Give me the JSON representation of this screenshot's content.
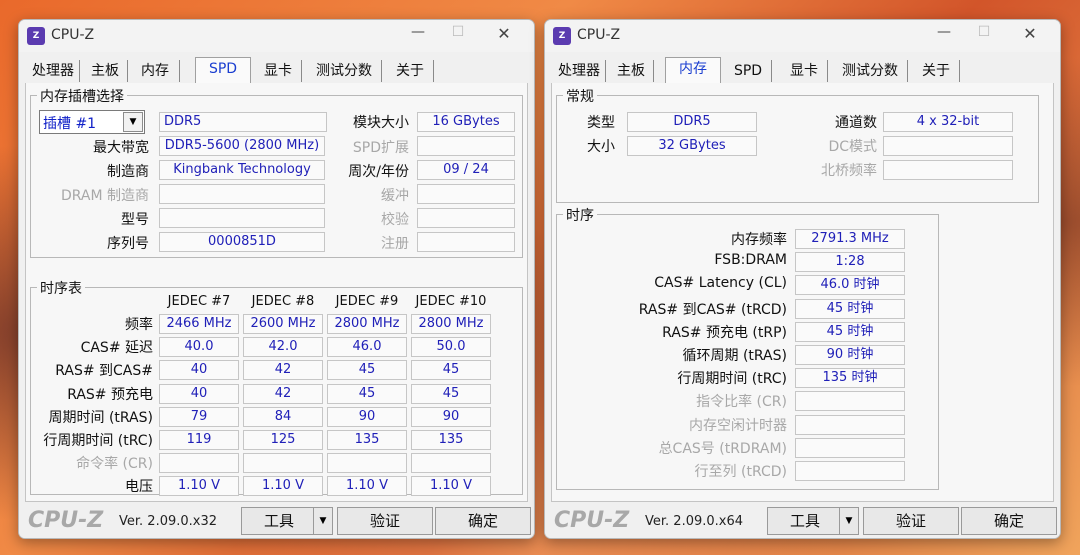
{
  "left_window": {
    "title": "CPU-Z",
    "tabs": [
      "处理器",
      "主板",
      "内存",
      "SPD",
      "显卡",
      "测试分数",
      "关于"
    ],
    "active_tab": "SPD",
    "slot_group": {
      "title": "内存插槽选择",
      "slot_select": "插槽 #1",
      "type": "DDR5",
      "module_size_label": "模块大小",
      "module_size": "16 GBytes",
      "max_bandwidth_label": "最大带宽",
      "max_bandwidth": "DDR5-5600 (2800 MHz)",
      "spd_ext_label": "SPD扩展",
      "spd_ext": "",
      "manufacturer_label": "制造商",
      "manufacturer": "Kingbank Technology",
      "week_year_label": "周次/年份",
      "week_year": "09 / 24",
      "dram_mfr_label": "DRAM 制造商",
      "dram_mfr": "",
      "buffer_label": "缓冲",
      "buffer": "",
      "part_label": "型号",
      "part": "",
      "check_label": "校验",
      "check": "",
      "serial_label": "序列号",
      "serial": "0000851D",
      "reg_label": "注册",
      "reg": ""
    },
    "timing_group": {
      "title": "时序表",
      "columns": [
        "JEDEC #7",
        "JEDEC #8",
        "JEDEC #9",
        "JEDEC #10"
      ],
      "rows": [
        {
          "label": "频率",
          "values": [
            "2466 MHz",
            "2600 MHz",
            "2800 MHz",
            "2800 MHz"
          ]
        },
        {
          "label": "CAS# 延迟",
          "values": [
            "40.0",
            "42.0",
            "46.0",
            "50.0"
          ]
        },
        {
          "label": "RAS# 到CAS#",
          "values": [
            "40",
            "42",
            "45",
            "45"
          ]
        },
        {
          "label": "RAS# 预充电",
          "values": [
            "40",
            "42",
            "45",
            "45"
          ]
        },
        {
          "label": "周期时间 (tRAS)",
          "values": [
            "79",
            "84",
            "90",
            "90"
          ]
        },
        {
          "label": "行周期时间 (tRC)",
          "values": [
            "119",
            "125",
            "135",
            "135"
          ]
        },
        {
          "label": "命令率 (CR)",
          "values": [
            "",
            "",
            "",
            ""
          ]
        },
        {
          "label": "电压",
          "values": [
            "1.10 V",
            "1.10 V",
            "1.10 V",
            "1.10 V"
          ]
        }
      ]
    },
    "footer": {
      "brand": "CPU-Z",
      "version": "Ver. 2.09.0.x32",
      "tools": "工具",
      "validate": "验证",
      "ok": "确定"
    }
  },
  "right_window": {
    "title": "CPU-Z",
    "tabs": [
      "处理器",
      "主板",
      "内存",
      "SPD",
      "显卡",
      "测试分数",
      "关于"
    ],
    "active_tab": "内存",
    "general": {
      "title": "常规",
      "type_label": "类型",
      "type": "DDR5",
      "channels_label": "通道数",
      "channels": "4 x 32-bit",
      "size_label": "大小",
      "size": "32 GBytes",
      "dc_mode_label": "DC模式",
      "dc_mode": "",
      "nb_freq_label": "北桥频率",
      "nb_freq": ""
    },
    "timings": {
      "title": "时序",
      "rows": [
        {
          "label": "内存频率",
          "value": "2791.3 MHz"
        },
        {
          "label": "FSB:DRAM",
          "value": "1:28"
        },
        {
          "label": "CAS# Latency (CL)",
          "value": "46.0 时钟"
        },
        {
          "label": "RAS# 到CAS# (tRCD)",
          "value": "45 时钟"
        },
        {
          "label": "RAS# 预充电 (tRP)",
          "value": "45 时钟"
        },
        {
          "label": "循环周期 (tRAS)",
          "value": "90 时钟"
        },
        {
          "label": "行周期时间 (tRC)",
          "value": "135 时钟"
        },
        {
          "label": "指令比率 (CR)",
          "value": ""
        },
        {
          "label": "内存空闲计时器",
          "value": ""
        },
        {
          "label": "总CAS号 (tRDRAM)",
          "value": ""
        },
        {
          "label": "行至列 (tRCD)",
          "value": ""
        }
      ]
    },
    "footer": {
      "brand": "CPU-Z",
      "version": "Ver. 2.09.0.x64",
      "tools": "工具",
      "validate": "验证",
      "ok": "确定"
    }
  }
}
